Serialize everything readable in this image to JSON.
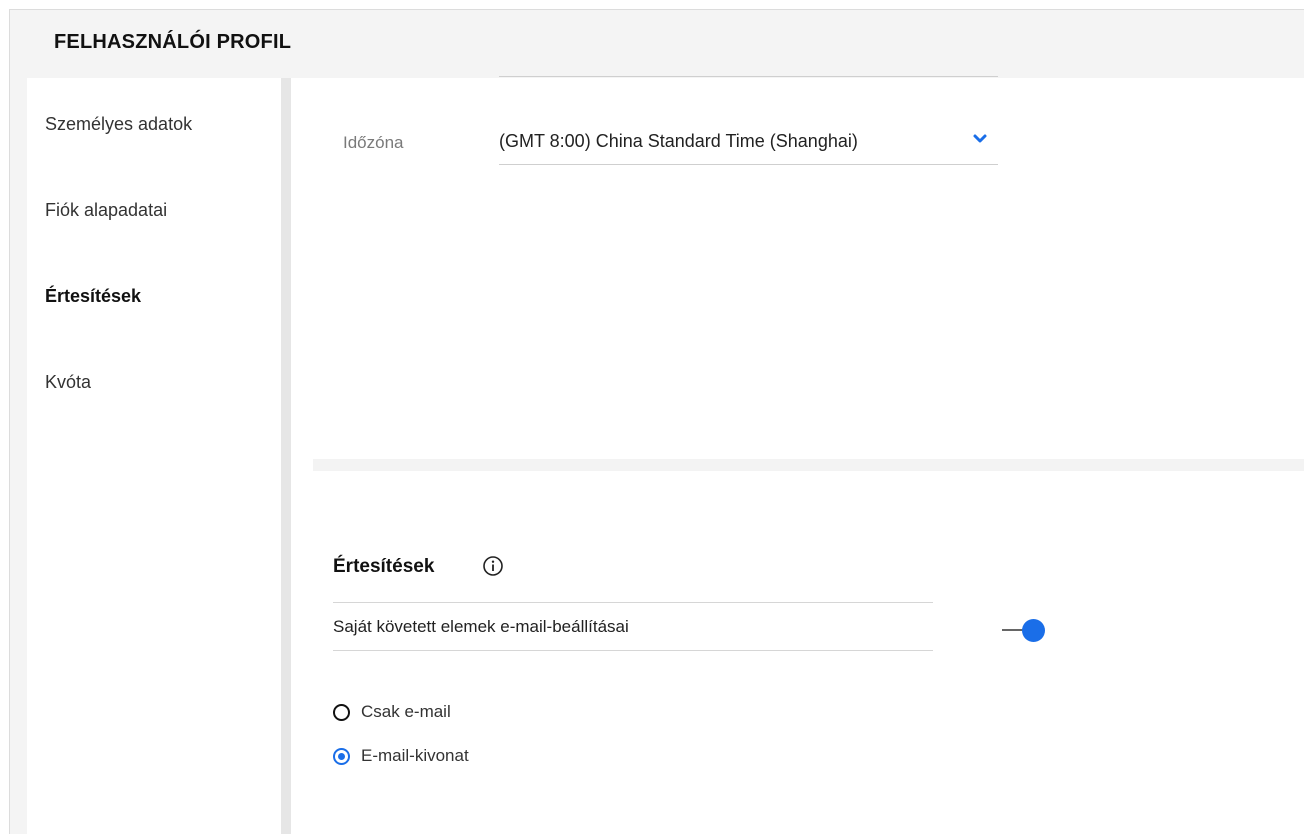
{
  "page": {
    "title": "FELHASZNÁLÓI PROFIL"
  },
  "sidebar": {
    "items": [
      {
        "label": "Személyes adatok",
        "active": false
      },
      {
        "label": "Fiók alapadatai",
        "active": false
      },
      {
        "label": "Értesítések",
        "active": true
      },
      {
        "label": "Kvóta",
        "active": false
      }
    ]
  },
  "timezone": {
    "label": "Időzóna",
    "value": "(GMT 8:00) China Standard Time (Shanghai)"
  },
  "notifications": {
    "heading": "Értesítések",
    "email_setting_label": "Saját követett elemek e-mail-beállításai",
    "email_toggle_on": true,
    "options": [
      {
        "label": "Csak e-mail",
        "selected": false
      },
      {
        "label": "E-mail-kivonat",
        "selected": true
      }
    ]
  },
  "colors": {
    "accent": "#1a6ee8"
  },
  "icons": {
    "dropdown": "chevron-down-icon",
    "info": "info-icon"
  }
}
